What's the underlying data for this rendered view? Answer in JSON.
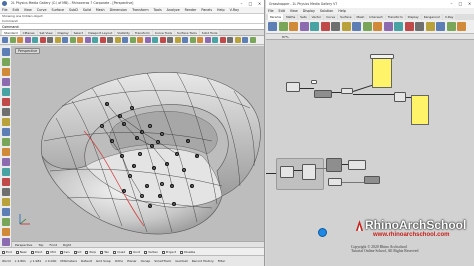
{
  "rhino": {
    "title": "2L Physics Media Gallery (C:\\ of MB) - Rhinoceros 7 Corporate - [Perspective]",
    "menu": [
      "File",
      "Edit",
      "View",
      "Curve",
      "Surface",
      "SubD",
      "Solid",
      "Mesh",
      "Dimension",
      "Transform",
      "Tools",
      "Analyze",
      "Render",
      "Panels",
      "Help",
      "V-Ray"
    ],
    "command_history": [
      "Showing one hidden object",
      "Command:"
    ],
    "command_prompt": "Command:",
    "toolbar_tabs": [
      "Standard",
      "CPlanes",
      "Set View",
      "Display",
      "Select",
      "Viewport Layout",
      "Visibility",
      "Transform",
      "Curve Tools",
      "Surface Tools",
      "Solid Tools"
    ],
    "active_tab": "Standard",
    "viewport_label": "Perspective",
    "viewport_tabs": [
      "Perspective",
      "Top",
      "Front",
      "Right"
    ],
    "osnaps": [
      "End",
      "Near",
      "Point",
      "Mid",
      "Cen",
      "Int",
      "Perp",
      "Tan",
      "Quad",
      "Knot",
      "Vertex",
      "Project",
      "Disable"
    ],
    "status": [
      "World",
      "x 4.801",
      "y 1.981",
      "z 0.000",
      "Millimeters",
      "Default",
      "Grid Snap",
      "Ortho",
      "Planar",
      "Osnap",
      "SmartTrack",
      "Gumball",
      "Record History",
      "Filter"
    ],
    "point_labels": [
      "3",
      "3",
      "3",
      "3",
      "4",
      "5",
      "6",
      "1",
      "2",
      "2",
      "6",
      "3",
      "8",
      "8",
      "6",
      "8",
      "8",
      "8",
      "2",
      "8",
      "8",
      "4",
      "5",
      "2",
      "2",
      "4",
      "3",
      "1",
      "2",
      "3",
      "5"
    ]
  },
  "grasshopper": {
    "title": "Grasshopper - 2L Physics Media Gallery V7",
    "menu": [
      "File",
      "Edit",
      "View",
      "Display",
      "Solution",
      "Help"
    ],
    "tabs": [
      "Params",
      "Maths",
      "Sets",
      "Vector",
      "Curve",
      "Surface",
      "Mesh",
      "Intersect",
      "Transform",
      "Display",
      "Kangaroo2",
      "V-Ray"
    ],
    "active_tab": "Params",
    "canvas_zoom": "87%",
    "canvas_name": "2L Physics Media Gallery V7",
    "brand_name": "RhinoArchSchool",
    "brand_url": "www.rhinoarchschool.com",
    "copyright": [
      "Copyright © 2020 Rhino Archschool",
      "Tutorial Online School, All Rights Reserved"
    ]
  },
  "colors": {
    "panel_yellow": "#fff36a",
    "wire": "#2d2d2d",
    "blob_blue": "#1e88e5",
    "brand_red": "#c8201a"
  }
}
